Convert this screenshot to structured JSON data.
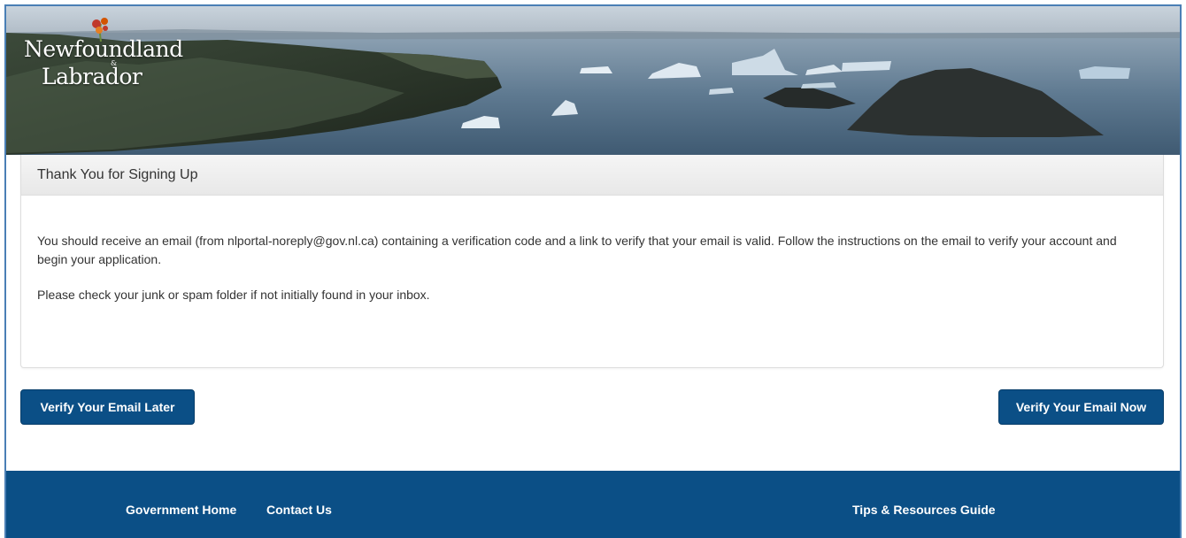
{
  "header": {
    "logo_line1": "Newfoundland",
    "logo_amp": "&",
    "logo_line2": "Labrador"
  },
  "panel": {
    "title": "Thank You for Signing Up",
    "paragraph1": "You should receive an email (from nlportal-noreply@gov.nl.ca) containing a verification code and a link to verify that your email is valid. Follow the instructions on the email to verify your account and begin your application.",
    "paragraph2": "Please check your junk or spam folder if not initially found in your inbox."
  },
  "actions": {
    "later_label": "Verify Your Email Later",
    "now_label": "Verify Your Email Now"
  },
  "footer": {
    "home_label": "Government Home",
    "contact_label": "Contact Us",
    "tips_label": "Tips & Resources Guide"
  },
  "colors": {
    "primary": "#0b4f86",
    "footer_bg": "#0b4f86",
    "frame_border": "#4a7fb5"
  },
  "icons": {
    "logo_flower": "pitcher-plant-flower-icon"
  }
}
